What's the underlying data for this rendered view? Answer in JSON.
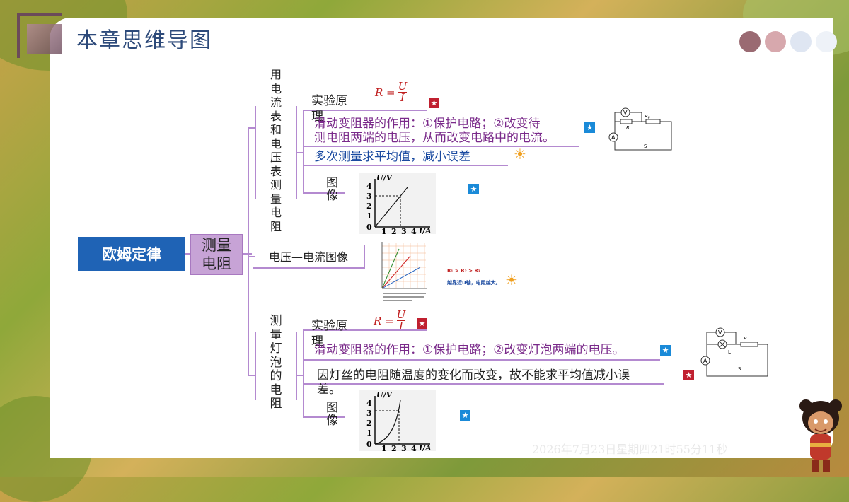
{
  "title": "本章思维导图",
  "root": "欧姆定律",
  "level1": "测量电阻",
  "branch_top": {
    "label_chars": [
      "用",
      "电",
      "流",
      "表",
      "和",
      "电",
      "压",
      "表",
      "测",
      "量",
      "电",
      "阻"
    ],
    "principle_label": "实验原理",
    "formula": {
      "lhs": "R =",
      "num": "U",
      "den": "I"
    },
    "rheostat_line1": "滑动变阻器的作用：①保护电路；②改变待",
    "rheostat_line2": "测电阻两端的电压，从而改变电路中的电流。",
    "average": "多次测量求平均值，减小误差",
    "graph_label": "图像",
    "graph": {
      "ylabel": "U/V",
      "xlabel": "I/A",
      "yticks": [
        "4",
        "3",
        "2",
        "1",
        "0"
      ],
      "xticks": [
        "1",
        "2",
        "3",
        "4"
      ]
    }
  },
  "branch_mid": {
    "label": "电压—电流图像",
    "note1": "R₁ > R₂ > R₃",
    "note2": "越靠近U轴，电阻越大。"
  },
  "branch_bottom": {
    "label_chars": [
      "测",
      "量",
      "灯",
      "泡",
      "的",
      "电",
      "阻"
    ],
    "principle_label": "实验原理",
    "formula": {
      "lhs": "R =",
      "num": "U",
      "den": "I"
    },
    "rheostat": "滑动变阻器的作用：①保护电路；②改变灯泡两端的电压。",
    "filament_line1": "因灯丝的电阻随温度的变化而改变，故不能求平均值减小误",
    "filament_line2": "差。",
    "graph_label": "图像",
    "graph": {
      "ylabel": "U/V",
      "xlabel": "I/A",
      "yticks": [
        "4",
        "3",
        "2",
        "1",
        "0"
      ],
      "xticks": [
        "1",
        "2",
        "3",
        "4"
      ]
    }
  },
  "circuit_top": {
    "v": "V",
    "a": "A",
    "r": "R",
    "rp": "Rₚ",
    "s": "S"
  },
  "circuit_bottom": {
    "v": "V",
    "a": "A",
    "l": "L",
    "p": "P",
    "s": "S"
  },
  "timestamp": "2026年7月23日星期四21时55分11秒",
  "colors": {
    "accent": "#1f63b5",
    "node_purple": "#c7a3d6",
    "line": "#b48ad0"
  }
}
